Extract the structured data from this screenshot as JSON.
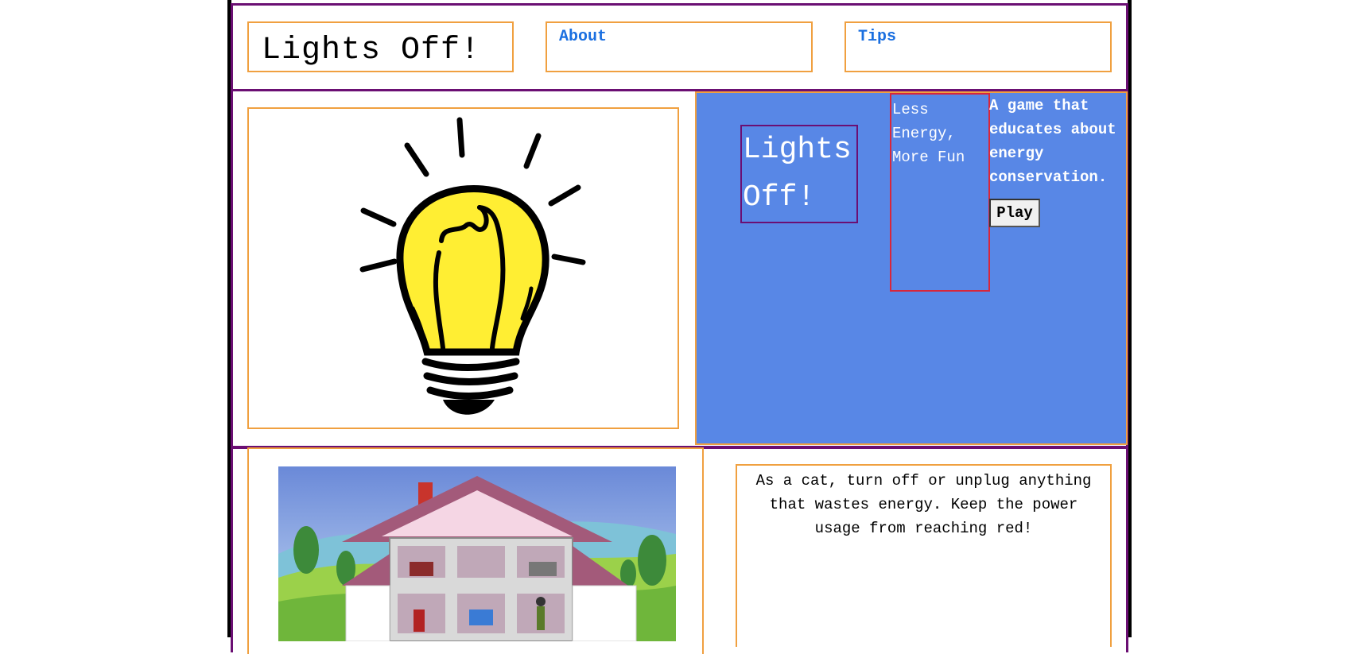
{
  "header": {
    "logo": "Lights Off!",
    "nav": [
      {
        "label": "About"
      },
      {
        "label": "Tips"
      }
    ]
  },
  "hero": {
    "title": "Lights Off!",
    "tagline": "Less Energy, More Fun",
    "description": "A game that educates about energy conservation.",
    "play_label": "Play",
    "background_color": "#5887e6"
  },
  "instructions": {
    "text": "As a cat, turn off or unplug anything that wastes energy. Keep the power usage from reaching red!"
  },
  "icons": {
    "bulb": "lightbulb-illustration",
    "house": "house-cutaway-illustration"
  }
}
